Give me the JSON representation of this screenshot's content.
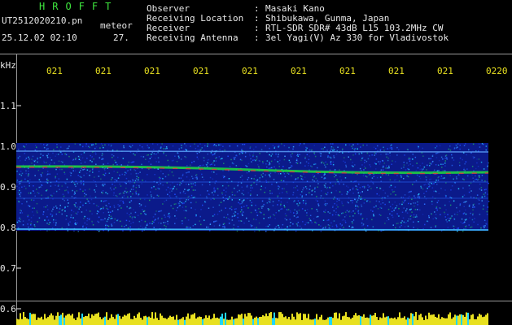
{
  "header": {
    "brand": "HROFFT",
    "filename": "UT2512020210.pn",
    "mode": "meteor",
    "datetime": "25.12.02 02:10",
    "count": "27."
  },
  "info": [
    {
      "label": "Observer",
      "value": "Masaki Kano"
    },
    {
      "label": "Receiving Location",
      "value": "Shibukawa, Gunma, Japan"
    },
    {
      "label": "Receiver",
      "value": "RTL-SDR SDR# 43dB L15 103.2MHz CW"
    },
    {
      "label": "Receiving Antenna",
      "value": "3el Yagi(V) Az 330 for Vladivostok"
    }
  ],
  "axis": {
    "unit": "kHz",
    "y_ticks": [
      "1.1",
      "1.0",
      "0.9",
      "0.8",
      "0.7",
      "0.6"
    ],
    "x_ticks": [
      "021",
      "021",
      "021",
      "021",
      "021",
      "021",
      "021",
      "021",
      "021",
      "0220"
    ]
  },
  "colors": {
    "text": "#e8e8e8",
    "accent_green": "#3ee63e",
    "accent_yellow": "#e8e020",
    "background": "#000000"
  }
}
